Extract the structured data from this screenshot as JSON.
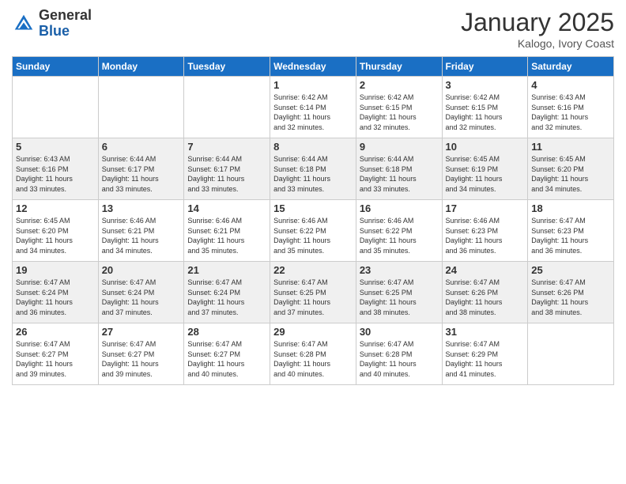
{
  "header": {
    "logo_general": "General",
    "logo_blue": "Blue",
    "month_title": "January 2025",
    "location": "Kalogo, Ivory Coast"
  },
  "weekdays": [
    "Sunday",
    "Monday",
    "Tuesday",
    "Wednesday",
    "Thursday",
    "Friday",
    "Saturday"
  ],
  "weeks": [
    [
      {
        "day": "",
        "info": ""
      },
      {
        "day": "",
        "info": ""
      },
      {
        "day": "",
        "info": ""
      },
      {
        "day": "1",
        "info": "Sunrise: 6:42 AM\nSunset: 6:14 PM\nDaylight: 11 hours\nand 32 minutes."
      },
      {
        "day": "2",
        "info": "Sunrise: 6:42 AM\nSunset: 6:15 PM\nDaylight: 11 hours\nand 32 minutes."
      },
      {
        "day": "3",
        "info": "Sunrise: 6:42 AM\nSunset: 6:15 PM\nDaylight: 11 hours\nand 32 minutes."
      },
      {
        "day": "4",
        "info": "Sunrise: 6:43 AM\nSunset: 6:16 PM\nDaylight: 11 hours\nand 32 minutes."
      }
    ],
    [
      {
        "day": "5",
        "info": "Sunrise: 6:43 AM\nSunset: 6:16 PM\nDaylight: 11 hours\nand 33 minutes."
      },
      {
        "day": "6",
        "info": "Sunrise: 6:44 AM\nSunset: 6:17 PM\nDaylight: 11 hours\nand 33 minutes."
      },
      {
        "day": "7",
        "info": "Sunrise: 6:44 AM\nSunset: 6:17 PM\nDaylight: 11 hours\nand 33 minutes."
      },
      {
        "day": "8",
        "info": "Sunrise: 6:44 AM\nSunset: 6:18 PM\nDaylight: 11 hours\nand 33 minutes."
      },
      {
        "day": "9",
        "info": "Sunrise: 6:44 AM\nSunset: 6:18 PM\nDaylight: 11 hours\nand 33 minutes."
      },
      {
        "day": "10",
        "info": "Sunrise: 6:45 AM\nSunset: 6:19 PM\nDaylight: 11 hours\nand 34 minutes."
      },
      {
        "day": "11",
        "info": "Sunrise: 6:45 AM\nSunset: 6:20 PM\nDaylight: 11 hours\nand 34 minutes."
      }
    ],
    [
      {
        "day": "12",
        "info": "Sunrise: 6:45 AM\nSunset: 6:20 PM\nDaylight: 11 hours\nand 34 minutes."
      },
      {
        "day": "13",
        "info": "Sunrise: 6:46 AM\nSunset: 6:21 PM\nDaylight: 11 hours\nand 34 minutes."
      },
      {
        "day": "14",
        "info": "Sunrise: 6:46 AM\nSunset: 6:21 PM\nDaylight: 11 hours\nand 35 minutes."
      },
      {
        "day": "15",
        "info": "Sunrise: 6:46 AM\nSunset: 6:22 PM\nDaylight: 11 hours\nand 35 minutes."
      },
      {
        "day": "16",
        "info": "Sunrise: 6:46 AM\nSunset: 6:22 PM\nDaylight: 11 hours\nand 35 minutes."
      },
      {
        "day": "17",
        "info": "Sunrise: 6:46 AM\nSunset: 6:23 PM\nDaylight: 11 hours\nand 36 minutes."
      },
      {
        "day": "18",
        "info": "Sunrise: 6:47 AM\nSunset: 6:23 PM\nDaylight: 11 hours\nand 36 minutes."
      }
    ],
    [
      {
        "day": "19",
        "info": "Sunrise: 6:47 AM\nSunset: 6:24 PM\nDaylight: 11 hours\nand 36 minutes."
      },
      {
        "day": "20",
        "info": "Sunrise: 6:47 AM\nSunset: 6:24 PM\nDaylight: 11 hours\nand 37 minutes."
      },
      {
        "day": "21",
        "info": "Sunrise: 6:47 AM\nSunset: 6:24 PM\nDaylight: 11 hours\nand 37 minutes."
      },
      {
        "day": "22",
        "info": "Sunrise: 6:47 AM\nSunset: 6:25 PM\nDaylight: 11 hours\nand 37 minutes."
      },
      {
        "day": "23",
        "info": "Sunrise: 6:47 AM\nSunset: 6:25 PM\nDaylight: 11 hours\nand 38 minutes."
      },
      {
        "day": "24",
        "info": "Sunrise: 6:47 AM\nSunset: 6:26 PM\nDaylight: 11 hours\nand 38 minutes."
      },
      {
        "day": "25",
        "info": "Sunrise: 6:47 AM\nSunset: 6:26 PM\nDaylight: 11 hours\nand 38 minutes."
      }
    ],
    [
      {
        "day": "26",
        "info": "Sunrise: 6:47 AM\nSunset: 6:27 PM\nDaylight: 11 hours\nand 39 minutes."
      },
      {
        "day": "27",
        "info": "Sunrise: 6:47 AM\nSunset: 6:27 PM\nDaylight: 11 hours\nand 39 minutes."
      },
      {
        "day": "28",
        "info": "Sunrise: 6:47 AM\nSunset: 6:27 PM\nDaylight: 11 hours\nand 40 minutes."
      },
      {
        "day": "29",
        "info": "Sunrise: 6:47 AM\nSunset: 6:28 PM\nDaylight: 11 hours\nand 40 minutes."
      },
      {
        "day": "30",
        "info": "Sunrise: 6:47 AM\nSunset: 6:28 PM\nDaylight: 11 hours\nand 40 minutes."
      },
      {
        "day": "31",
        "info": "Sunrise: 6:47 AM\nSunset: 6:29 PM\nDaylight: 11 hours\nand 41 minutes."
      },
      {
        "day": "",
        "info": ""
      }
    ]
  ]
}
